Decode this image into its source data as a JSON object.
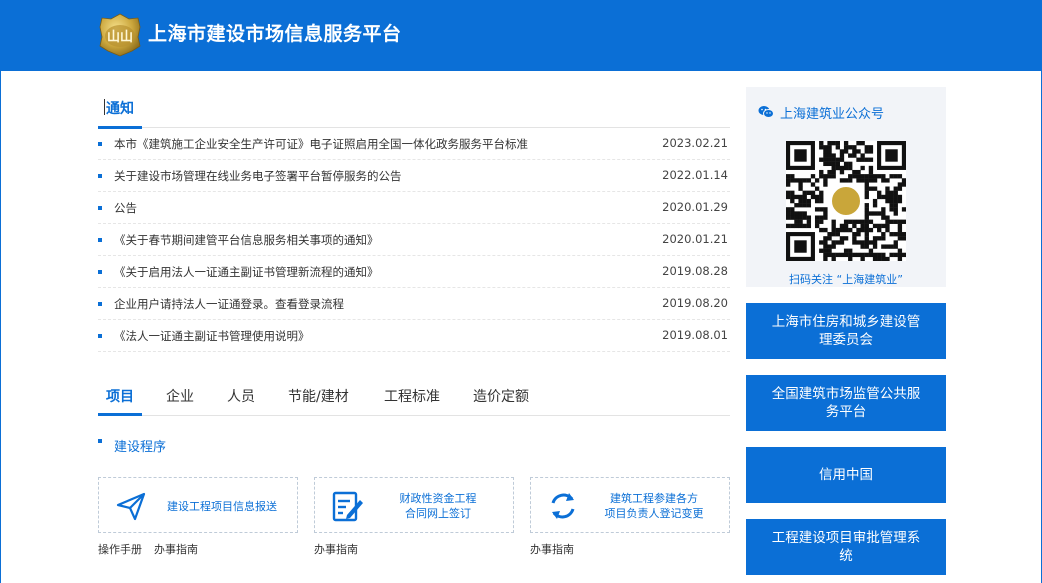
{
  "header": {
    "site_title": "上海市建设市场信息服务平台",
    "logo_text": "山山",
    "bg_color": "#0b6fd6",
    "logo_icon": "gold-emblem-icon"
  },
  "notices": {
    "title": "通知",
    "items": [
      {
        "text": "本市《建筑施工企业安全生产许可证》电子证照启用全国一体化政务服务平台标准",
        "date": "2023.02.21"
      },
      {
        "text": "关于建设市场管理在线业务电子签署平台暂停服务的公告",
        "date": "2022.01.14"
      },
      {
        "text": "公告",
        "date": "2020.01.29"
      },
      {
        "text": "《关于春节期间建管平台信息服务相关事项的通知》",
        "date": "2020.01.21"
      },
      {
        "text": "《关于启用法人一证通主副证书管理新流程的通知》",
        "date": "2019.08.28"
      },
      {
        "text": "企业用户请持法人一证通登录。查看登录流程",
        "date": "2019.08.20"
      },
      {
        "text": "《法人一证通主副证书管理使用说明》",
        "date": "2019.08.01"
      }
    ]
  },
  "tabs": [
    {
      "label": "项目",
      "active": true
    },
    {
      "label": "企业",
      "active": false
    },
    {
      "label": "人员",
      "active": false
    },
    {
      "label": "节能/建材",
      "active": false
    },
    {
      "label": "工程标准",
      "active": false
    },
    {
      "label": "造价定额",
      "active": false
    }
  ],
  "section": {
    "label": "建设程序"
  },
  "cards": [
    {
      "text": "建设工程项目信息报送",
      "icon": "paper-plane-icon",
      "links": [
        "操作手册",
        "办事指南"
      ]
    },
    {
      "text": "财政性资金工程\n合同网上签订",
      "icon": "edit-form-icon",
      "links": [
        "办事指南"
      ]
    },
    {
      "text": "建筑工程参建各方\n项目负责人登记变更",
      "icon": "refresh-icon",
      "links": [
        "办事指南"
      ]
    }
  ],
  "wechat": {
    "title": "上海建筑业公众号",
    "caption": "扫码关注 “上海建筑业”",
    "icon": "wechat-icon"
  },
  "side_links": [
    "上海市住房和城乡建设管理委员会",
    "全国建筑市场监管公共服务平台",
    "信用中国",
    "工程建设项目审批管理系统"
  ],
  "colors": {
    "accent": "#0b6fd6",
    "gold": "#c9a63a"
  }
}
